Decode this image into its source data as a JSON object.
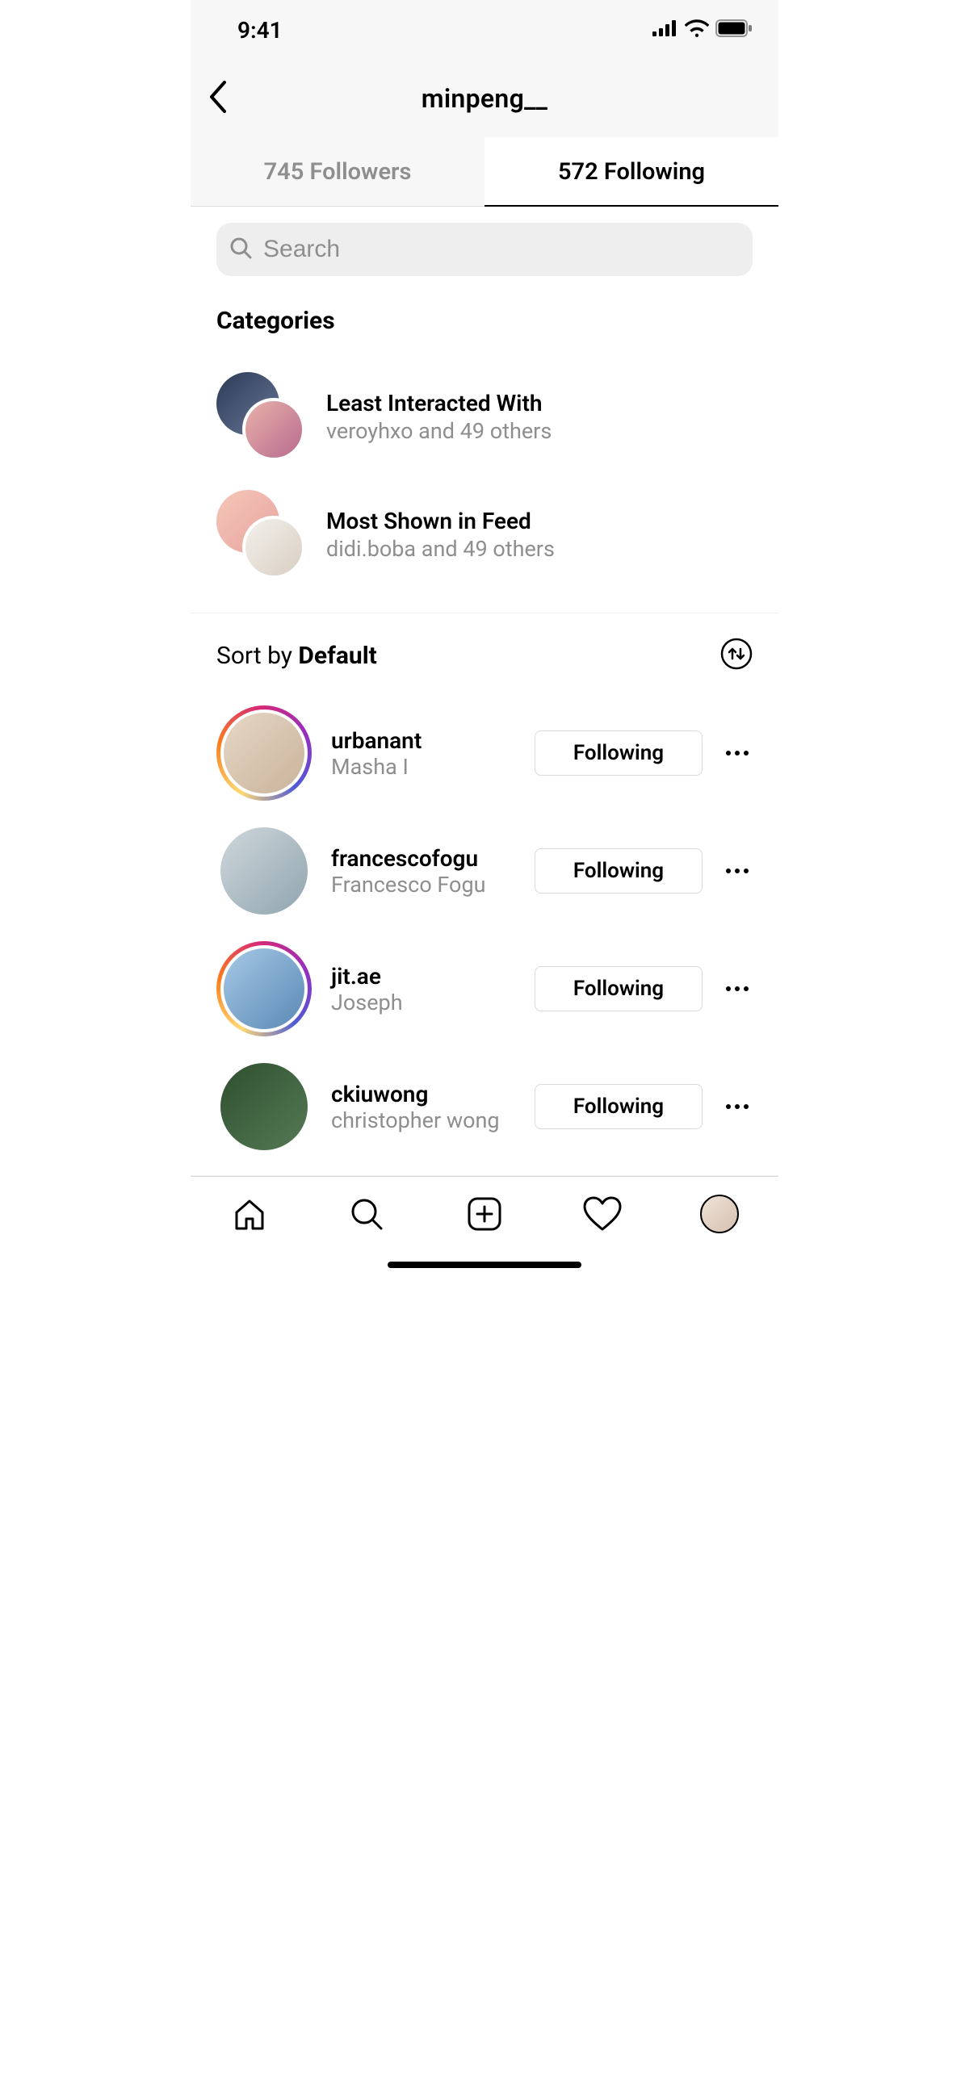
{
  "status": {
    "time": "9:41"
  },
  "header": {
    "title": "minpeng__"
  },
  "tabs": {
    "followers": "745 Followers",
    "following": "572 Following"
  },
  "search": {
    "placeholder": "Search"
  },
  "categories": {
    "heading": "Categories",
    "items": [
      {
        "title": "Least Interacted With",
        "sub": "veroyhxo and 49 others"
      },
      {
        "title": "Most Shown in Feed",
        "sub": "didi.boba and 49 others"
      }
    ]
  },
  "sort": {
    "prefix": "Sort by ",
    "value": "Default"
  },
  "users": [
    {
      "username": "urbanant",
      "display": "Masha I",
      "button": "Following",
      "story": true
    },
    {
      "username": "francescofogu",
      "display": "Francesco Fogu",
      "button": "Following",
      "story": false
    },
    {
      "username": "jit.ae",
      "display": "Joseph",
      "button": "Following",
      "story": true
    },
    {
      "username": "ckiuwong",
      "display": "christopher wong",
      "button": "Following",
      "story": false
    }
  ]
}
